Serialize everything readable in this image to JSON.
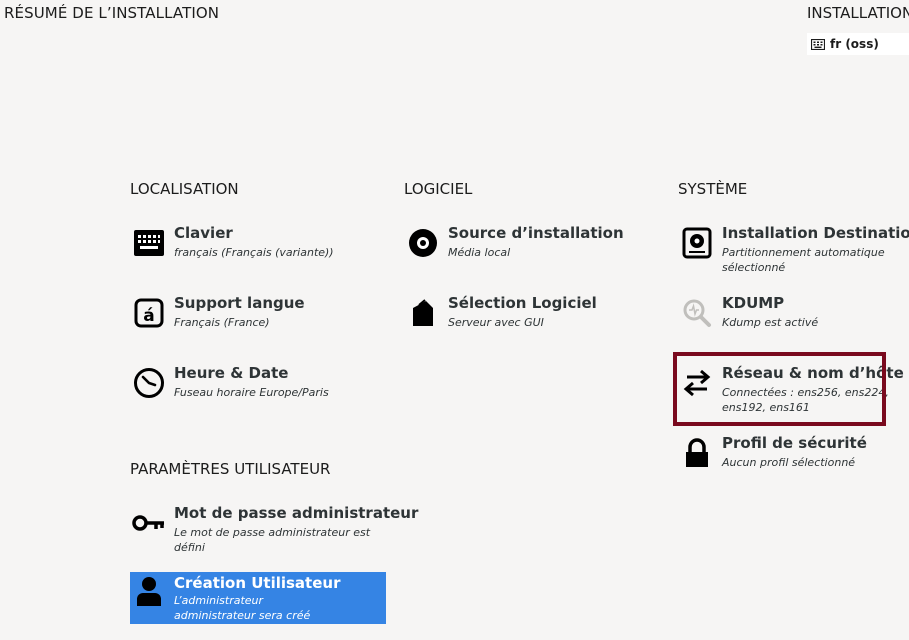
{
  "header": {
    "title": "RÉSUMÉ DE L’INSTALLATION",
    "install_title": "INSTALLATION",
    "keyboard_layout": "fr (oss)"
  },
  "sections": {
    "localisation": {
      "title": "LOCALISATION",
      "items": [
        {
          "label": "Clavier",
          "status": "français (Français (variante))",
          "icon": "keyboard-icon"
        },
        {
          "label": "Support langue",
          "status": "Français (France)",
          "icon": "language-icon"
        },
        {
          "label": "Heure & Date",
          "status": "Fuseau horaire Europe/Paris",
          "icon": "clock-icon"
        }
      ]
    },
    "logiciel": {
      "title": "LOGICIEL",
      "items": [
        {
          "label": "Source d’installation",
          "status": "Média local",
          "icon": "disc-icon"
        },
        {
          "label": "Sélection Logiciel",
          "status": "Serveur avec GUI",
          "icon": "package-icon"
        }
      ]
    },
    "systeme": {
      "title": "SYSTÈME",
      "items": [
        {
          "label": "Installation Destination",
          "status": "Partitionnement automatique sélectionné",
          "icon": "harddisk-icon"
        },
        {
          "label": "KDUMP",
          "status": "Kdump est activé",
          "icon": "search-icon"
        },
        {
          "label": "Réseau & nom d’hôte",
          "status": "Connectées : ens256, ens224, ens192, ens161",
          "icon": "network-icon"
        },
        {
          "label": "Profil de sécurité",
          "status": "Aucun profil sélectionné",
          "icon": "lock-icon"
        }
      ]
    },
    "utilisateur": {
      "title": "PARAMÈTRES UTILISATEUR",
      "items": [
        {
          "label": "Mot de passe administrateur",
          "status": "Le mot de passe administrateur est défini",
          "icon": "key-icon"
        },
        {
          "label": "Création Utilisateur",
          "status": "L’administrateur administrateur sera créé",
          "icon": "user-icon"
        }
      ]
    }
  },
  "colors": {
    "background": "#f6f5f4",
    "selected": "#3584e4",
    "highlight": "#7a0a1e"
  }
}
